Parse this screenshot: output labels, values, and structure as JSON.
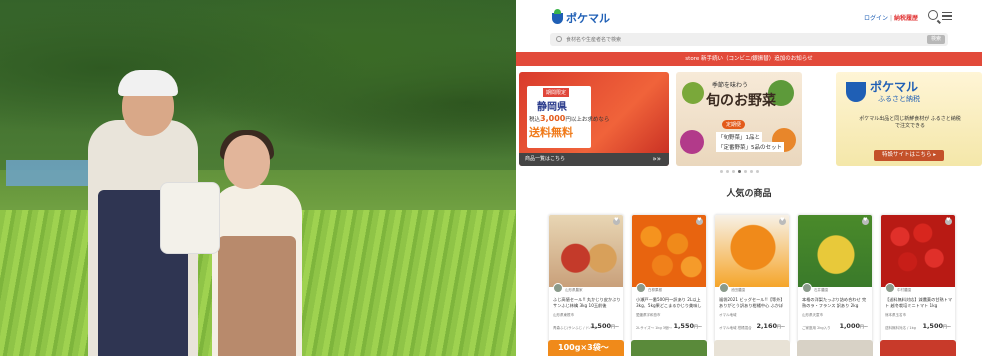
{
  "hero": {},
  "header": {
    "logo_text": "ポケマル",
    "login": "ログイン",
    "separator": "|",
    "tax_link": "納税履歴"
  },
  "search": {
    "placeholder": "食材名や生産者名で検索",
    "button": "検索"
  },
  "notice": "store 新手続い（コンビニ/銀振替）追加のお知らせ",
  "banners": [
    {
      "tag": "期間限定",
      "pref": "静岡県",
      "price_prefix": "税込",
      "price_value": "3,000",
      "price_suffix": "円以上お求めなら",
      "free": "送料無料",
      "footer": "商品一覧はこちら",
      "arrow": "»»"
    },
    {
      "line1": "季節を味わう",
      "line2": "旬のお野菜",
      "tag": "定期便",
      "set1": "「旬野菜」1品と",
      "set2": "「定番野菜」5品のセット"
    },
    {
      "brand": "ポケマル",
      "brand2": "ふるさと納税",
      "desc": "ポケマル出品と同じ新鮮食材が ふるさと納税で注文できる",
      "button": "特設サイトはこちら ▸"
    }
  ],
  "section_title": "人気の商品",
  "products": [
    {
      "shop": "山形県農家",
      "name": "ふじ高値セール!! 丸かじり皮かぶり サンふじ林檎 3kg 10玉前後",
      "loc": "山形県東根市",
      "meta": "青森ふじ/サンふじ / ドバリー",
      "price": "1,500",
      "unit": "円〜",
      "colors": [
        "#c9a07a",
        "#e8d6b4"
      ]
    },
    {
      "shop": "白柳果樹",
      "name": "小瀬戸一番500円〜訳あり 2L以上 3kg、5kg果どこまるかじり美味しい",
      "loc": "愛媛県宇和島市",
      "meta": "2Lサイズ〜 1kg 3個〜",
      "price": "1,550",
      "unit": "円〜",
      "colors": [
        "#f07a1a",
        "#e8640f"
      ]
    },
    {
      "shop": "池田農園",
      "name": "福袋2021 ビッグセール!!【等外】 ありがとう訳あり柑橘中心 ふかぼり",
      "loc": "オマル地域",
      "meta": "オマル地域 柑橘混合",
      "price": "2,160",
      "unit": "円〜",
      "colors": [
        "#f08a1a",
        "#f5a52a"
      ]
    },
    {
      "shop": "石井農園",
      "name": "本格の洋梨たっぷり詰め合わせ 完熟のラ・フランス 訳あり 2kg",
      "loc": "山形県天童市",
      "meta": "ご家庭用 2kg入り",
      "price": "1,000",
      "unit": "円〜",
      "colors": [
        "#3a7a2a",
        "#e8c93a"
      ]
    },
    {
      "shop": "中村農園",
      "name": "【送料無料対応】減農薬の甘熟トマト 越冬栽培ミニトマト 1kg",
      "loc": "熊本県玉名市",
      "meta": "送料無料対応 / 1kg",
      "price": "1,500",
      "unit": "円〜",
      "colors": [
        "#d8261e",
        "#b81a14"
      ]
    }
  ],
  "row2_banner": "100g×3袋〜"
}
